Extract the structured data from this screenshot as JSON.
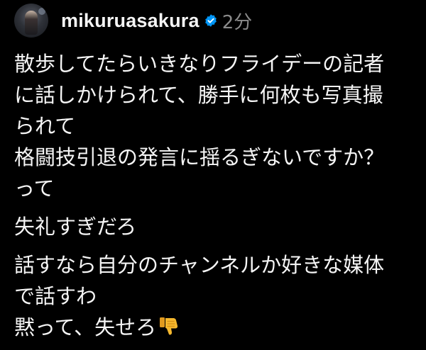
{
  "post": {
    "author": {
      "username": "mikuruasakura",
      "verified": true,
      "avatar_icon": "avatar-photo"
    },
    "timestamp": "2分",
    "paragraphs": [
      {
        "lines": [
          "散歩してたらいきなりフライデーの記者",
          "に話しかけられて、勝手に何枚も写真撮",
          "られて",
          "格闘技引退の発言に揺るぎないですか？",
          "って"
        ]
      },
      {
        "lines": [
          "失礼すぎだろ"
        ]
      },
      {
        "lines": [
          "話すなら自分のチャンネルか好きな媒体",
          "で話すわ",
          "黙って、失せろ"
        ],
        "trailing_emoji": "thumbs-down-emoji"
      }
    ]
  },
  "colors": {
    "background": "#000000",
    "text": "#f5f5f5",
    "muted": "#8a8a8a",
    "verified_badge": "#0095f6",
    "emoji": "#f5b82e"
  }
}
